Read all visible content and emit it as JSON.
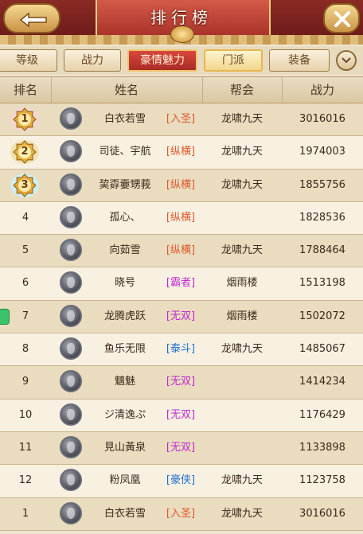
{
  "header": {
    "title": "排行榜"
  },
  "tabs": [
    {
      "label": "等级"
    },
    {
      "label": "战力"
    },
    {
      "label": "豪情魅力"
    },
    {
      "label": "门派"
    },
    {
      "label": "装备"
    }
  ],
  "columns": {
    "rank": "排名",
    "name": "姓名",
    "guild": "帮会",
    "power": "战力"
  },
  "rows": [
    {
      "rank": "1",
      "name": "白衣若雪",
      "faction": "[入圣]",
      "faction_color": "#e0582c",
      "guild": "龙啸九天",
      "power": "3016016"
    },
    {
      "rank": "2",
      "name": "司徒、宇航",
      "faction": "[纵横]",
      "faction_color": "#e0582c",
      "guild": "龙啸九天",
      "power": "1974003"
    },
    {
      "rank": "3",
      "name": "巭孬嫑甥莪",
      "faction": "[纵横]",
      "faction_color": "#e0582c",
      "guild": "龙啸九天",
      "power": "1855756"
    },
    {
      "rank": "4",
      "name": "孤心、",
      "faction": "[纵横]",
      "faction_color": "#e0582c",
      "guild": "",
      "power": "1828536"
    },
    {
      "rank": "5",
      "name": "向茹雪",
      "faction": "[纵横]",
      "faction_color": "#e0582c",
      "guild": "龙啸九天",
      "power": "1788464"
    },
    {
      "rank": "6",
      "name": "晓号",
      "faction": "[霸者]",
      "faction_color": "#c02ad0",
      "guild": "烟雨楼",
      "power": "1513198"
    },
    {
      "rank": "7",
      "name": "龙腾虎跃",
      "faction": "[无双]",
      "faction_color": "#c02ad0",
      "guild": "烟雨楼",
      "power": "1502072"
    },
    {
      "rank": "8",
      "name": "鱼乐无限",
      "faction": "[泰斗]",
      "faction_color": "#1f6fd0",
      "guild": "龙啸九天",
      "power": "1485067"
    },
    {
      "rank": "9",
      "name": "魑魅",
      "faction": "[无双]",
      "faction_color": "#c02ad0",
      "guild": "",
      "power": "1414234"
    },
    {
      "rank": "10",
      "name": "ジ清逸ぷ",
      "faction": "[无双]",
      "faction_color": "#c02ad0",
      "guild": "",
      "power": "1176429"
    },
    {
      "rank": "11",
      "name": "見山黃泉",
      "faction": "[无双]",
      "faction_color": "#c02ad0",
      "guild": "",
      "power": "1133898"
    },
    {
      "rank": "12",
      "name": "粉凤凰",
      "faction": "[豪侠]",
      "faction_color": "#1f6fd0",
      "guild": "龙啸九天",
      "power": "1123758"
    },
    {
      "rank": "1",
      "name": "白衣若雪",
      "faction": "[入圣]",
      "faction_color": "#e0582c",
      "guild": "龙啸九天",
      "power": "3016016"
    }
  ]
}
